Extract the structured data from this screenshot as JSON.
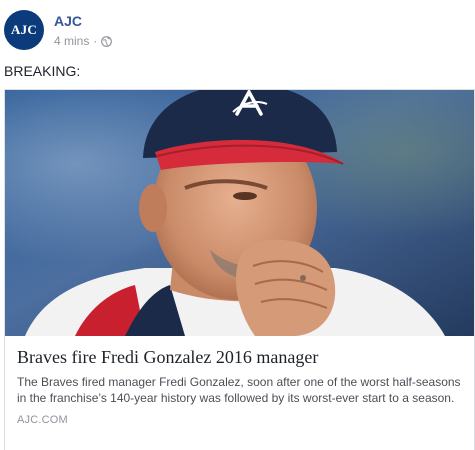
{
  "post": {
    "page_name": "AJC",
    "avatar_text": "AJC",
    "timestamp": "4 mins",
    "separator": "·",
    "privacy_icon": "globe-icon",
    "text": "BREAKING:"
  },
  "link_card": {
    "image_icon": "news-photo",
    "title": "Braves fire Fredi Gonzalez 2016 manager",
    "description": "The Braves fired manager Fredi Gonzalez, soon after one of the worst half-seasons in the franchise’s 140-year history was followed by its worst-ever start to a season.",
    "domain": "AJC.COM"
  },
  "colors": {
    "brand_link": "#365899",
    "avatar_bg": "#0b3b7a",
    "cap_navy": "#1b2a48",
    "cap_bill_red": "#d52b3a",
    "meta_gray": "#90949c",
    "card_border": "#dddfe2"
  }
}
